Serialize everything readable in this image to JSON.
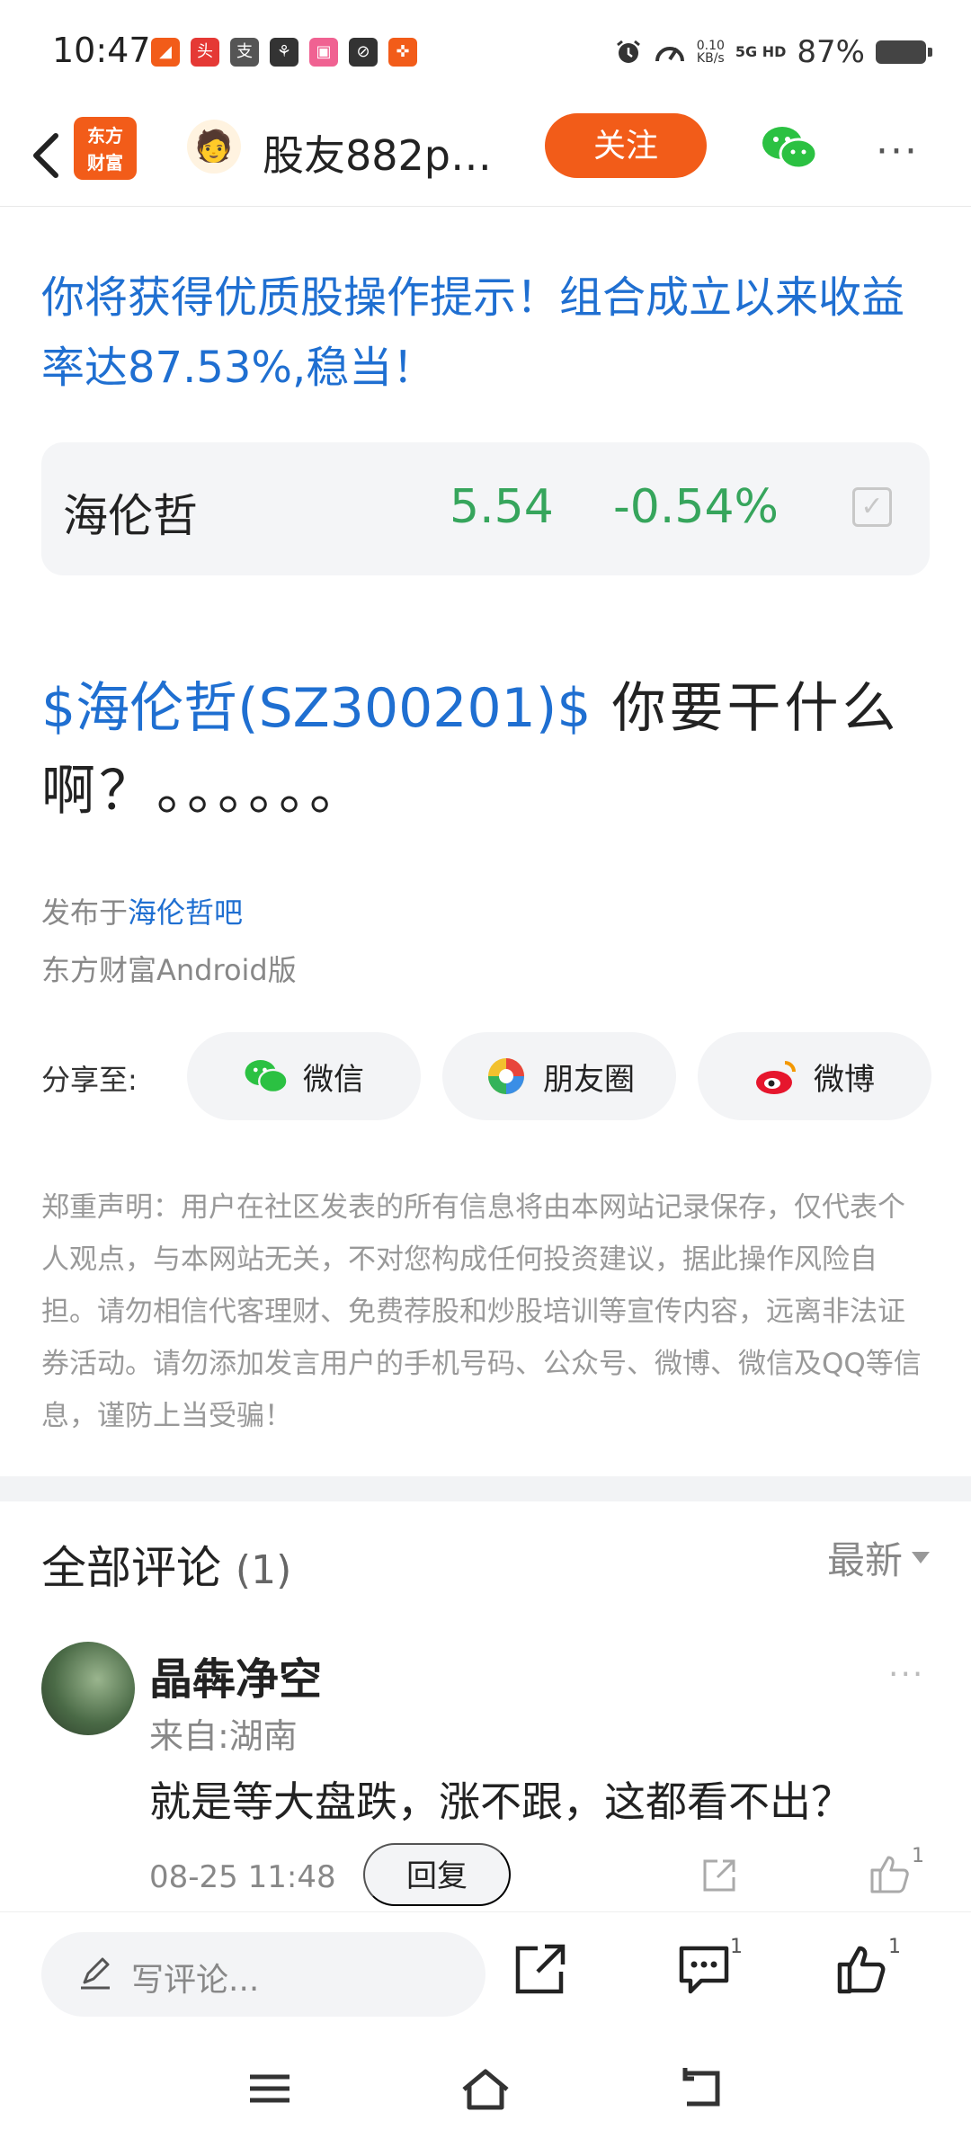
{
  "status_bar": {
    "time": "10:47",
    "apps": [
      {
        "icon": "send-app-icon",
        "color": "#f25c19",
        "glyph": "◢"
      },
      {
        "icon": "toutiao-app-icon",
        "color": "#e53935",
        "glyph": "头"
      },
      {
        "icon": "alipay-app-icon",
        "color": "#555555",
        "glyph": "支"
      },
      {
        "icon": "app-icon",
        "color": "#333333",
        "glyph": "⚘"
      },
      {
        "icon": "bilibili-app-icon",
        "color": "#f06292",
        "glyph": "▣"
      },
      {
        "icon": "app-icon",
        "color": "#333333",
        "glyph": "⊘"
      },
      {
        "icon": "app-icon",
        "color": "#f25c19",
        "glyph": "✜"
      }
    ],
    "net_speed": "0.10",
    "net_unit": "KB/s",
    "signal": "5G HD",
    "battery": "87%"
  },
  "nav": {
    "logo_line1": "东方",
    "logo_line2": "财富",
    "title": "股友882p…",
    "follow": "关注"
  },
  "promo_text": "你将获得优质股操作提示！组合成立以来收益率达87.53%,稳当！",
  "stock": {
    "name": "海伦哲",
    "price": "5.54",
    "change": "-0.54%",
    "change_color": "#36a55c"
  },
  "post": {
    "stock_link": "$海伦哲(SZ300201)$",
    "text": " 你要干什么啊？。。。。。。"
  },
  "meta": {
    "published_prefix": "发布于",
    "bar_name": "海伦哲吧",
    "client": "东方财富Android版"
  },
  "share": {
    "label": "分享至:",
    "wechat": "微信",
    "moments": "朋友圈",
    "weibo": "微博"
  },
  "disclaimer": "郑重声明：用户在社区发表的所有信息将由本网站记录保存，仅代表个人观点，与本网站无关，不对您构成任何投资建议，据此操作风险自担。请勿相信代客理财、免费荐股和炒股培训等宣传内容，远离非法证券活动。请勿添加发言用户的手机号码、公众号、微博、微信及QQ等信息，谨防上当受骗！",
  "comments": {
    "title": "全部评论",
    "count": "(1)",
    "sort": "最新",
    "items": [
      {
        "name": "晶犇净空",
        "from": "来自:湖南",
        "text": "就是等大盘跌，涨不跟，这都看不出？",
        "time": "08-25 11:48",
        "reply": "回复",
        "likes": "1"
      }
    ]
  },
  "bottom": {
    "write_placeholder": "写评论...",
    "comment_count": "1",
    "like_count": "1"
  },
  "colors": {
    "brand": "#f25c19",
    "link": "#1f6fd1",
    "down": "#36a55c"
  }
}
